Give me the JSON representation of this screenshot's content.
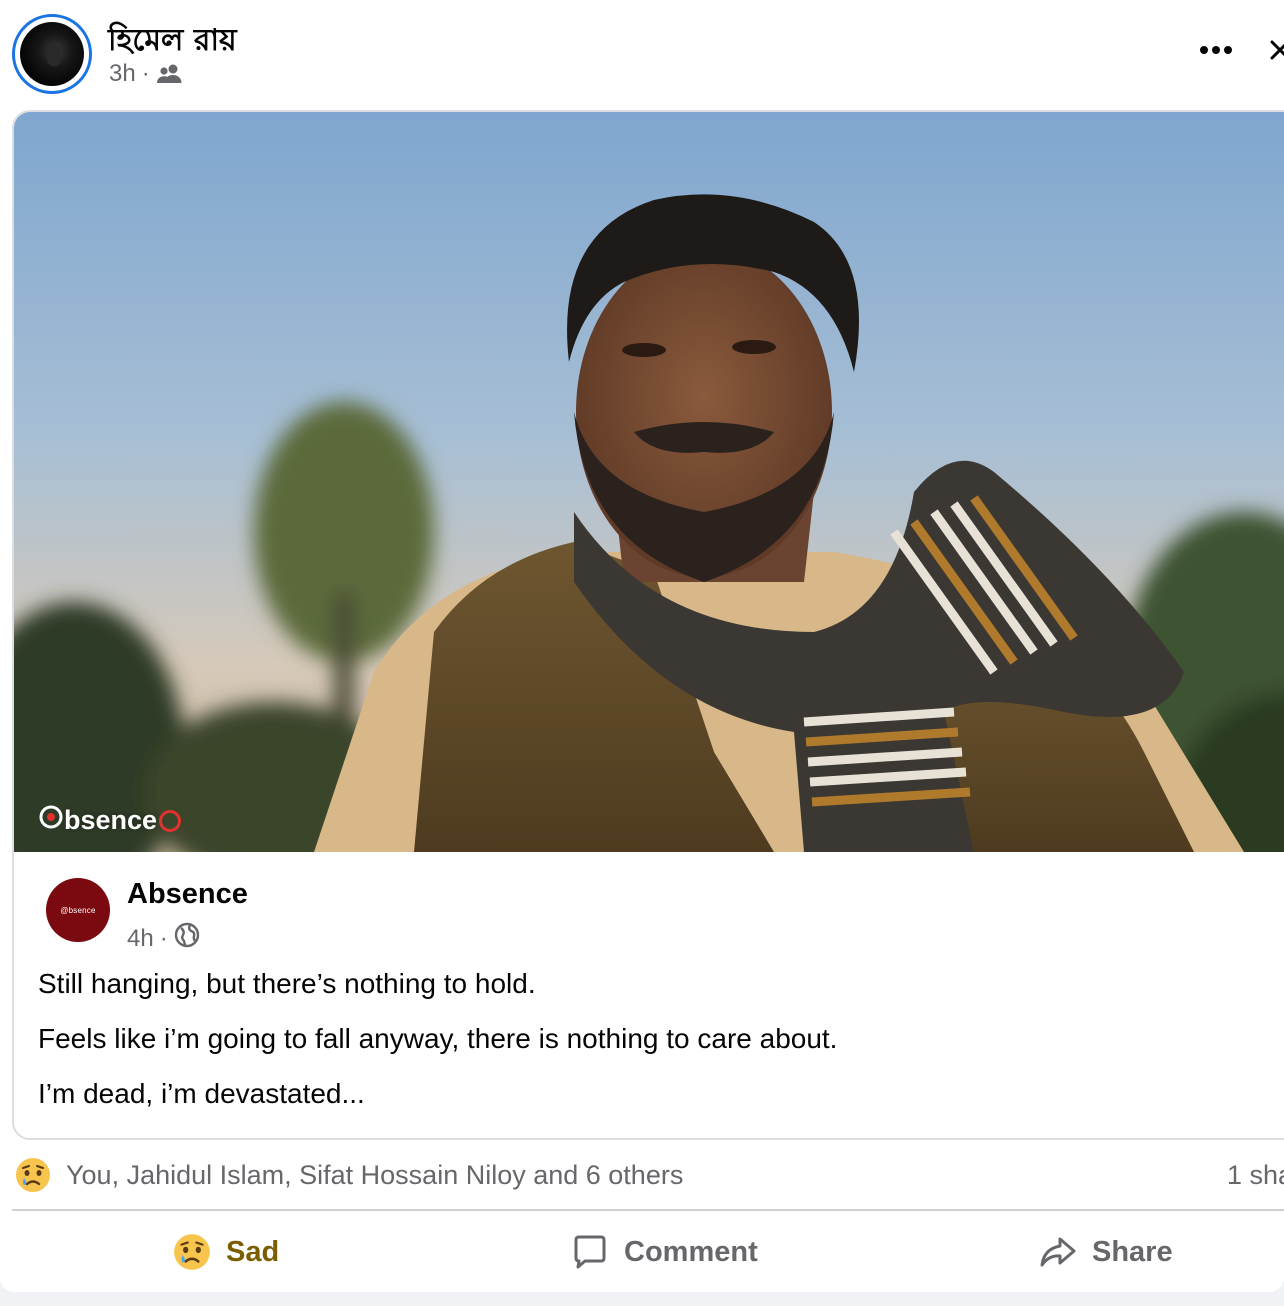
{
  "post": {
    "author": "হিমেল রায়",
    "time": "3h",
    "separator": "·",
    "audience_icon": "friends-icon",
    "more_icon": "more-dots-icon",
    "close_icon": "close-icon"
  },
  "shared": {
    "photo_watermark": "bsence",
    "page_avatar_text": "@bsence",
    "page_name": "Absence",
    "time": "4h",
    "separator": "·",
    "audience_icon": "globe-icon",
    "caption": [
      "Still hanging, but there’s nothing to hold.",
      "Feels like i’m going to fall anyway, there is nothing to care about.",
      "I’m dead, i’m devastated..."
    ]
  },
  "reactions": {
    "emoji": "sad-emoji-icon",
    "names": "You, Jahidul Islam, Sifat Hossain Niloy and 6 others",
    "shares": "1 sha"
  },
  "actions": {
    "sad_label": "Sad",
    "comment_label": "Comment",
    "share_label": "Share"
  },
  "colors": {
    "accent": "#1b74e4",
    "sad_reaction": "#7a5e00",
    "muted_text": "#65676b",
    "page_avatar_bg": "#7a0a0f"
  }
}
